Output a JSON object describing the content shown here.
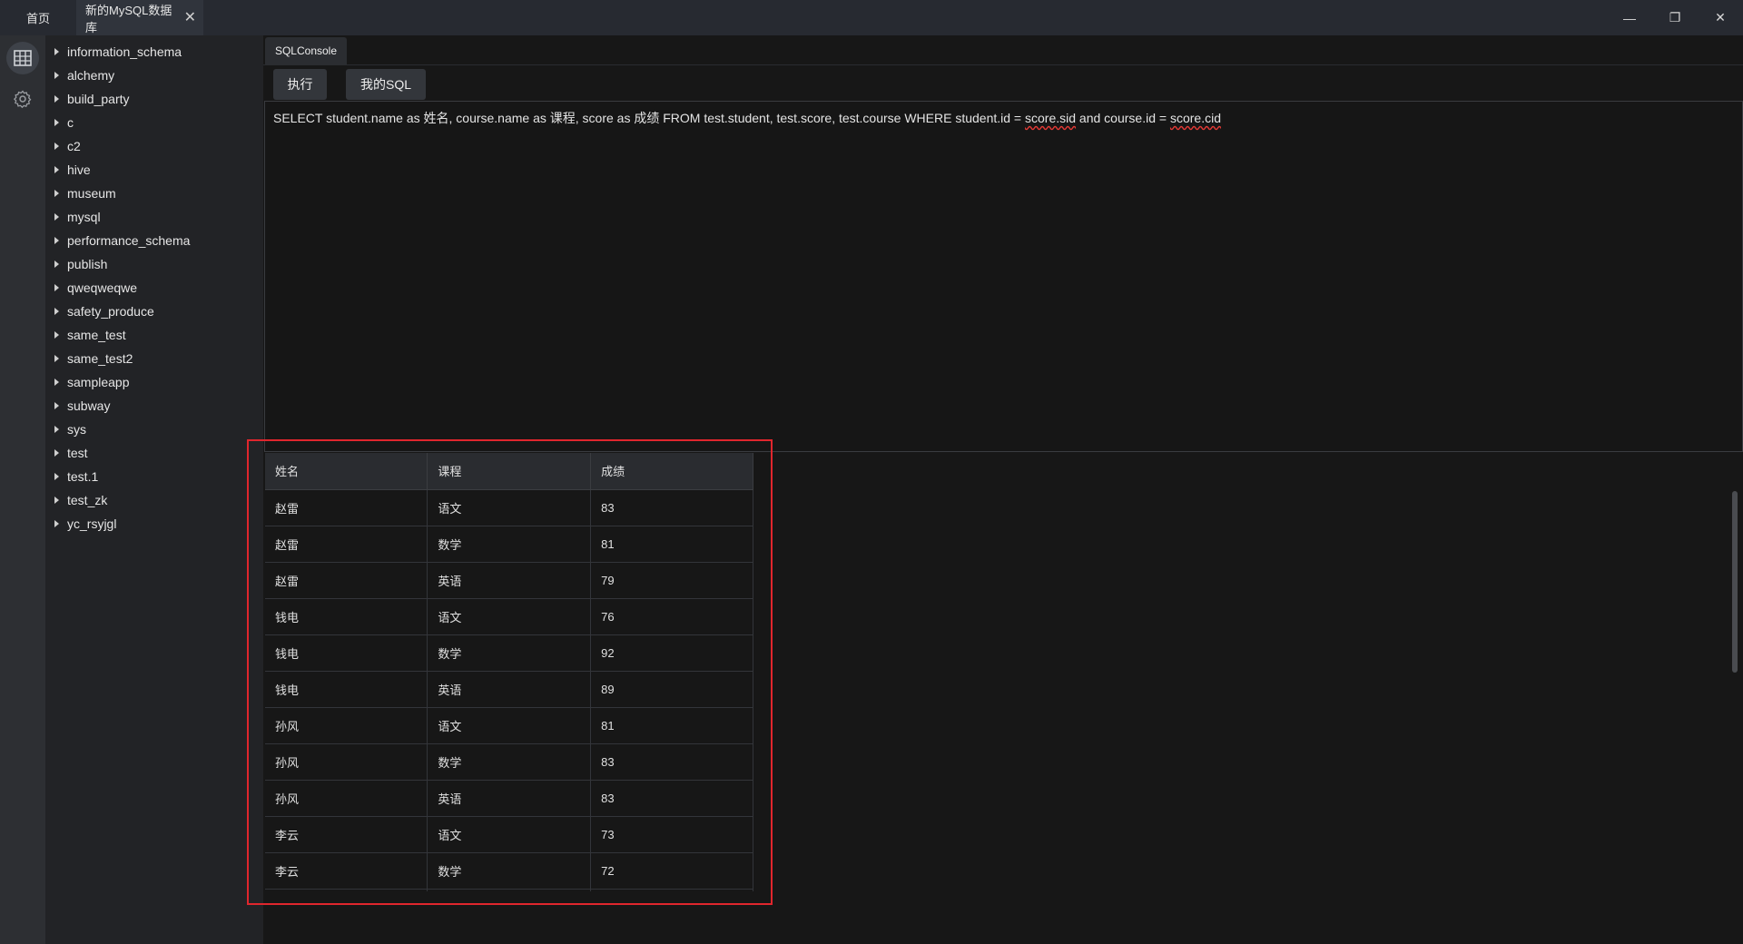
{
  "titlebar": {
    "tabs": [
      {
        "label": "首页"
      },
      {
        "label": "新的MySQL数据库",
        "close_glyph": "✕"
      }
    ],
    "window_controls": {
      "minimize": "—",
      "restore": "❐",
      "close": "✕"
    }
  },
  "activity_bar": {
    "items": [
      {
        "icon": "database-icon",
        "active": true
      },
      {
        "icon": "settings-gear-icon",
        "active": false
      }
    ]
  },
  "sidebar": {
    "databases": [
      "information_schema",
      "alchemy",
      "build_party",
      "c",
      "c2",
      "hive",
      "museum",
      "mysql",
      "performance_schema",
      "publish",
      "qweqweqwe",
      "safety_produce",
      "same_test",
      "same_test2",
      "sampleapp",
      "subway",
      "sys",
      "test",
      "test.1",
      "test_zk",
      "yc_rsyjgl"
    ]
  },
  "console": {
    "tab_label": "SQLConsole",
    "run_button": "执行",
    "my_sql_button": "我的SQL",
    "query_main": "SELECT student.name as 姓名, course.name as 课程, score as 成绩 FROM test.student, test.score, test.course WHERE student.id = ",
    "query_sid": "score.sid",
    "query_mid": " and course.id = ",
    "query_cid": "score.cid"
  },
  "results": {
    "columns": [
      "姓名",
      "课程",
      "成绩"
    ],
    "rows": [
      [
        "赵雷",
        "语文",
        "83"
      ],
      [
        "赵雷",
        "数学",
        "81"
      ],
      [
        "赵雷",
        "英语",
        "79"
      ],
      [
        "钱电",
        "语文",
        "76"
      ],
      [
        "钱电",
        "数学",
        "92"
      ],
      [
        "钱电",
        "英语",
        "89"
      ],
      [
        "孙风",
        "语文",
        "81"
      ],
      [
        "孙风",
        "数学",
        "83"
      ],
      [
        "孙风",
        "英语",
        "83"
      ],
      [
        "李云",
        "语文",
        "73"
      ],
      [
        "李云",
        "数学",
        "72"
      ],
      [
        "",
        "",
        ""
      ]
    ]
  },
  "colors": {
    "highlight_box": "#e0262d",
    "squiggle": "#e53935"
  }
}
